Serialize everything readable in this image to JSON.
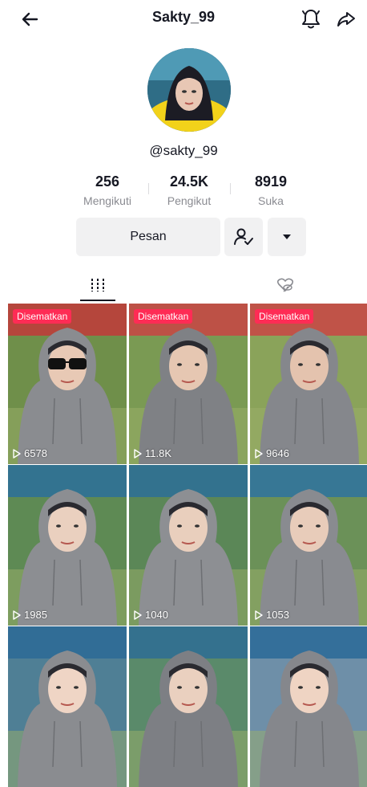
{
  "header": {
    "title": "Sakty_99"
  },
  "profile": {
    "handle": "@sakty_99"
  },
  "stats": [
    {
      "value": "256",
      "label": "Mengikuti"
    },
    {
      "value": "24.5K",
      "label": "Pengikut"
    },
    {
      "value": "8919",
      "label": "Suka"
    }
  ],
  "actions": {
    "message_label": "Pesan"
  },
  "colors": {
    "accent": "#fe2c55",
    "text": "#161823",
    "muted": "#8a8b91",
    "button_bg": "#f1f1f2"
  },
  "icons": [
    "back-arrow-icon",
    "bell-icon",
    "share-icon",
    "add-friend-icon",
    "dropdown-icon",
    "grid-videos-icon",
    "liked-hidden-icon",
    "play-icon"
  ],
  "videos": [
    {
      "badge": "Disematkan",
      "views": "6578"
    },
    {
      "badge": "Disematkan",
      "views": "11.8K"
    },
    {
      "badge": "Disematkan",
      "views": "9646"
    },
    {
      "badge": "",
      "views": "1985"
    },
    {
      "badge": "",
      "views": "1040"
    },
    {
      "badge": "",
      "views": "1053"
    },
    {
      "badge": "",
      "views": ""
    },
    {
      "badge": "",
      "views": ""
    },
    {
      "badge": "",
      "views": ""
    }
  ]
}
